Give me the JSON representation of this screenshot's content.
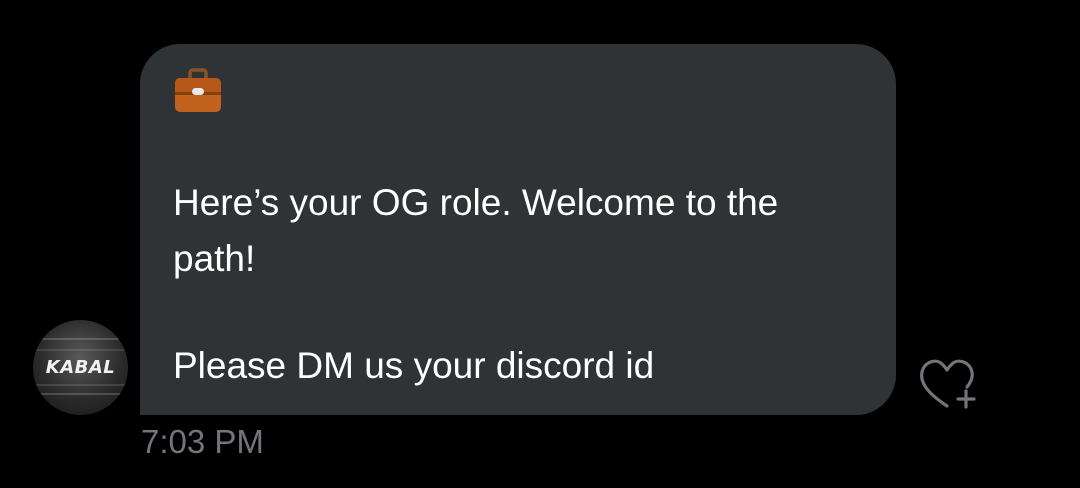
{
  "conversation": {
    "avatar": {
      "icon": "kabal-avatar",
      "label": "KABAL"
    },
    "message": {
      "emoji": "briefcase-icon",
      "line1": "Here’s your OG role. Welcome to the",
      "line2": "path!",
      "line3": "Please DM us your discord id",
      "timestamp": "7:03 PM"
    },
    "reaction": {
      "icon": "heart-plus-icon"
    }
  },
  "colors": {
    "background": "#000000",
    "bubble": "#2f3336",
    "text": "#ffffff",
    "muted": "#71767b",
    "briefcase": "#c1621e"
  }
}
